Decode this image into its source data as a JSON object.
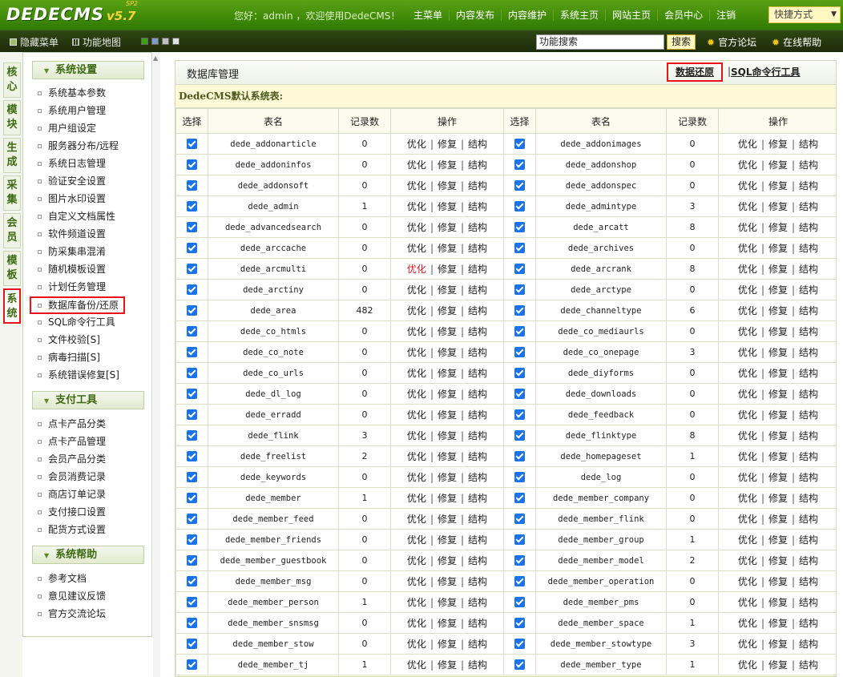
{
  "app": {
    "logo": "DEDECMS",
    "version": "v5.7",
    "edition": "SP2"
  },
  "header": {
    "welcome": "您好：admin ，欢迎使用DedeCMS！",
    "nav": [
      "主菜单",
      "内容发布",
      "内容维护",
      "系统主页",
      "网站主页",
      "会员中心",
      "注销"
    ],
    "quick": "快捷方式"
  },
  "subbar": {
    "hide_menu": "隐藏菜单",
    "sitemap": "功能地图",
    "colors": [
      "#3aa311",
      "#7d9ec4",
      "#bfbfbf",
      "#e0e0e0"
    ],
    "search_value": "功能搜索",
    "search_btn": "搜索",
    "forum": "官方论坛",
    "help": "在线帮助"
  },
  "lefttabs": [
    "核心",
    "模块",
    "生成",
    "采集",
    "会员",
    "模板",
    "系统"
  ],
  "menu": {
    "groups": [
      {
        "title": "系统设置",
        "items": [
          "系统基本参数",
          "系统用户管理",
          "用户组设定",
          "服务器分布/远程",
          "系统日志管理",
          "验证安全设置",
          "图片水印设置",
          "自定义文档属性",
          "软件频道设置",
          "防采集串混淆",
          "随机模板设置",
          "计划任务管理",
          "数据库备份/还原",
          "SQL命令行工具",
          "文件校验[S]",
          "病毒扫描[S]",
          "系统错误修复[S]"
        ]
      },
      {
        "title": "支付工具",
        "items": [
          "点卡产品分类",
          "点卡产品管理",
          "会员产品分类",
          "会员消费记录",
          "商店订单记录",
          "支付接口设置",
          "配货方式设置"
        ]
      },
      {
        "title": "系统帮助",
        "items": [
          "参考文档",
          "意见建议反馈",
          "官方交流论坛"
        ]
      }
    ]
  },
  "main": {
    "title": "数据库管理",
    "restore_link": "数据还原",
    "separator": "|",
    "sql_link": "SQL命令行工具",
    "caption": "DedeCMS默认系统表:",
    "headers": [
      "选择",
      "表名",
      "记录数",
      "操作",
      "选择",
      "表名",
      "记录数",
      "操作"
    ],
    "ops": [
      "优化",
      "修复",
      "结构"
    ],
    "op_sep": "|",
    "rows": [
      [
        [
          "dede_addonarticle",
          "0"
        ],
        [
          "dede_addonimages",
          "0"
        ]
      ],
      [
        [
          "dede_addoninfos",
          "0"
        ],
        [
          "dede_addonshop",
          "0"
        ]
      ],
      [
        [
          "dede_addonsoft",
          "0"
        ],
        [
          "dede_addonspec",
          "0"
        ]
      ],
      [
        [
          "dede_admin",
          "1"
        ],
        [
          "dede_admintype",
          "3"
        ]
      ],
      [
        [
          "dede_advancedsearch",
          "0"
        ],
        [
          "dede_arcatt",
          "8"
        ]
      ],
      [
        [
          "dede_arccache",
          "0"
        ],
        [
          "dede_archives",
          "0"
        ]
      ],
      [
        [
          "dede_arcmulti",
          "0"
        ],
        [
          "dede_arcrank",
          "8"
        ]
      ],
      [
        [
          "dede_arctiny",
          "0"
        ],
        [
          "dede_arctype",
          "0"
        ]
      ],
      [
        [
          "dede_area",
          "482"
        ],
        [
          "dede_channeltype",
          "6"
        ]
      ],
      [
        [
          "dede_co_htmls",
          "0"
        ],
        [
          "dede_co_mediaurls",
          "0"
        ]
      ],
      [
        [
          "dede_co_note",
          "0"
        ],
        [
          "dede_co_onepage",
          "3"
        ]
      ],
      [
        [
          "dede_co_urls",
          "0"
        ],
        [
          "dede_diyforms",
          "0"
        ]
      ],
      [
        [
          "dede_dl_log",
          "0"
        ],
        [
          "dede_downloads",
          "0"
        ]
      ],
      [
        [
          "dede_erradd",
          "0"
        ],
        [
          "dede_feedback",
          "0"
        ]
      ],
      [
        [
          "dede_flink",
          "3"
        ],
        [
          "dede_flinktype",
          "8"
        ]
      ],
      [
        [
          "dede_freelist",
          "2"
        ],
        [
          "dede_homepageset",
          "1"
        ]
      ],
      [
        [
          "dede_keywords",
          "0"
        ],
        [
          "dede_log",
          "0"
        ]
      ],
      [
        [
          "dede_member",
          "1"
        ],
        [
          "dede_member_company",
          "0"
        ]
      ],
      [
        [
          "dede_member_feed",
          "0"
        ],
        [
          "dede_member_flink",
          "0"
        ]
      ],
      [
        [
          "dede_member_friends",
          "0"
        ],
        [
          "dede_member_group",
          "1"
        ]
      ],
      [
        [
          "dede_member_guestbook",
          "0"
        ],
        [
          "dede_member_model",
          "2"
        ]
      ],
      [
        [
          "dede_member_msg",
          "0"
        ],
        [
          "dede_member_operation",
          "0"
        ]
      ],
      [
        [
          "dede_member_person",
          "1"
        ],
        [
          "dede_member_pms",
          "0"
        ]
      ],
      [
        [
          "dede_member_snsmsg",
          "0"
        ],
        [
          "dede_member_space",
          "1"
        ]
      ],
      [
        [
          "dede_member_stow",
          "0"
        ],
        [
          "dede_member_stowtype",
          "3"
        ]
      ],
      [
        [
          "dede_member_tj",
          "1"
        ],
        [
          "dede_member_type",
          "1"
        ]
      ]
    ]
  }
}
